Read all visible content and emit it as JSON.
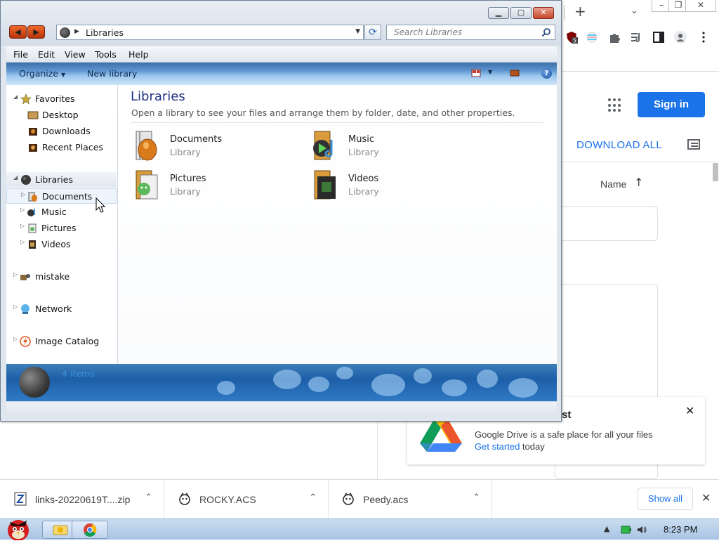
{
  "explorer": {
    "address": "Libraries",
    "search_placeholder": "Search Libraries",
    "menu": [
      "File",
      "Edit",
      "View",
      "Tools",
      "Help"
    ],
    "toolbar": {
      "organize": "Organize",
      "new_library": "New library"
    },
    "nav": {
      "favorites": "Favorites",
      "desktop": "Desktop",
      "downloads": "Downloads",
      "recent_places": "Recent Places",
      "libraries": "Libraries",
      "documents": "Documents",
      "music": "Music",
      "pictures": "Pictures",
      "videos": "Videos",
      "mistake": "mistake",
      "network": "Network",
      "image_catalog": "Image Catalog"
    },
    "content": {
      "title": "Libraries",
      "description": "Open a library to see your files and arrange them by folder, date, and other properties.",
      "items": [
        {
          "name": "Documents",
          "type": "Library"
        },
        {
          "name": "Music",
          "type": "Library"
        },
        {
          "name": "Pictures",
          "type": "Library"
        },
        {
          "name": "Videos",
          "type": "Library"
        }
      ]
    },
    "details": {
      "count": "4 items"
    }
  },
  "chrome": {
    "sign_in": "Sign in",
    "download_all": "DOWNLOAD ALL",
    "name_column": "Name",
    "toast": {
      "title_fragment": "st",
      "message": "Google Drive is a safe place for all your files",
      "link": "Get started",
      "suffix": " today"
    },
    "extension_badge": "5",
    "accent": "#1a73e8"
  },
  "downloads": {
    "items": [
      {
        "name": "links-20220619T....zip"
      },
      {
        "name": "ROCKY.ACS"
      },
      {
        "name": "Peedy.acs"
      }
    ],
    "show_all": "Show all"
  },
  "taskbar": {
    "time": "8:23 PM"
  }
}
